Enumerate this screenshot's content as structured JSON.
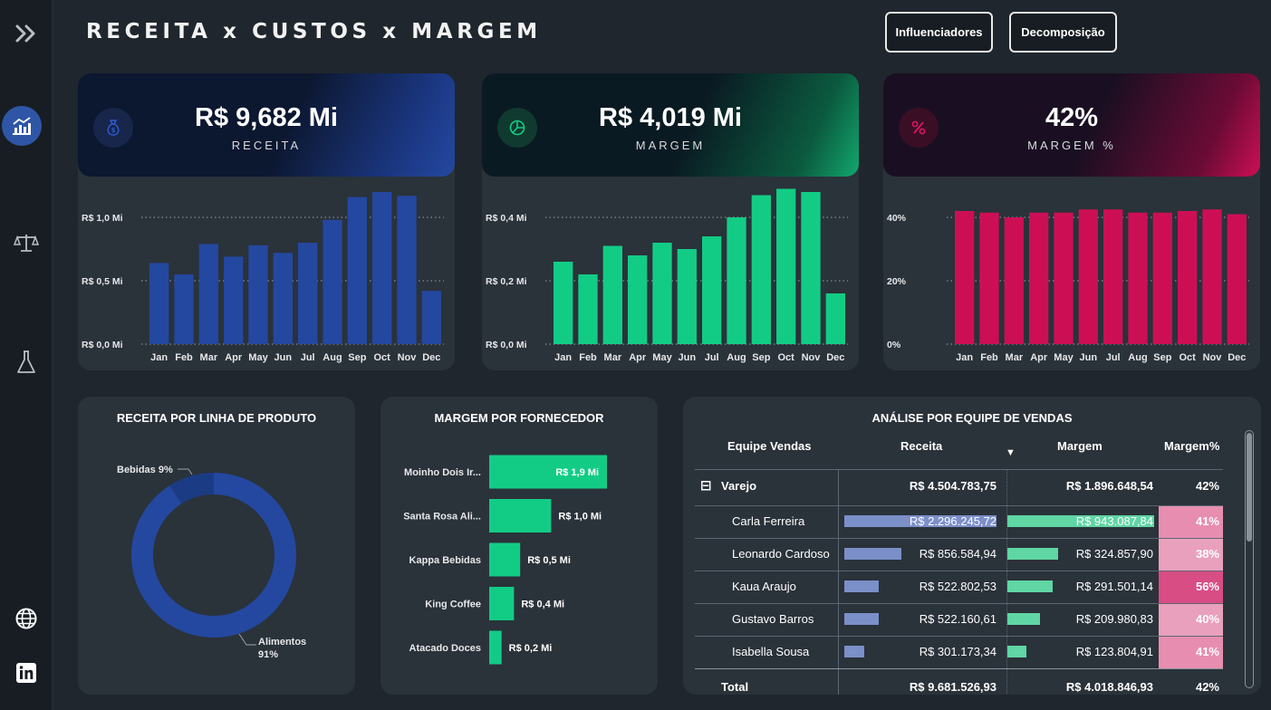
{
  "header": {
    "title": "RECEITA x CUSTOS x MARGEM",
    "buttons": {
      "influencers": "Influenciadores",
      "decomposition": "Decomposição"
    }
  },
  "sidebar": {
    "icons": [
      "expand-icon",
      "chart-trend-icon",
      "balance-scale-icon",
      "flask-icon",
      "globe-icon",
      "linkedin-icon"
    ]
  },
  "kpis": {
    "receita": {
      "value": "R$ 9,682 Mi",
      "label": "RECEITA",
      "color": "#2448a0"
    },
    "margem": {
      "value": "R$ 4,019 Mi",
      "label": "MARGEM",
      "color": "#12cc85"
    },
    "margem_pct": {
      "value": "42%",
      "label": "MARGEM %",
      "color": "#cc0f55"
    }
  },
  "chart_data": [
    {
      "type": "bar",
      "title": "",
      "categories": [
        "Jan",
        "Feb",
        "Mar",
        "Apr",
        "May",
        "Jun",
        "Jul",
        "Aug",
        "Sep",
        "Oct",
        "Nov",
        "Dec"
      ],
      "values": [
        0.64,
        0.55,
        0.79,
        0.69,
        0.78,
        0.72,
        0.8,
        0.98,
        1.16,
        1.2,
        1.17,
        0.42
      ],
      "ylim": [
        0,
        1.0
      ],
      "yticks": [
        0,
        0.5,
        1.0
      ],
      "ytick_labels": [
        "R$ 0,0 Mi",
        "R$ 0,5 Mi",
        "R$ 1,0 Mi"
      ],
      "color": "#2448a0",
      "grid": true
    },
    {
      "type": "bar",
      "title": "",
      "categories": [
        "Jan",
        "Feb",
        "Mar",
        "Apr",
        "May",
        "Jun",
        "Jul",
        "Aug",
        "Sep",
        "Oct",
        "Nov",
        "Dec"
      ],
      "values": [
        0.26,
        0.22,
        0.31,
        0.28,
        0.32,
        0.3,
        0.34,
        0.4,
        0.47,
        0.49,
        0.48,
        0.16
      ],
      "ylim": [
        0,
        0.4
      ],
      "yticks": [
        0,
        0.2,
        0.4
      ],
      "ytick_labels": [
        "R$ 0,0 Mi",
        "R$ 0,2 Mi",
        "R$ 0,4 Mi"
      ],
      "color": "#12cc85",
      "grid": true
    },
    {
      "type": "bar",
      "title": "",
      "categories": [
        "Jan",
        "Feb",
        "Mar",
        "Apr",
        "May",
        "Jun",
        "Jul",
        "Aug",
        "Sep",
        "Oct",
        "Nov",
        "Dec"
      ],
      "values": [
        42,
        41.5,
        40,
        41.5,
        41.5,
        42.5,
        42.5,
        41.5,
        41.5,
        42,
        42.5,
        41
      ],
      "ylim": [
        0,
        40
      ],
      "yticks": [
        0,
        20,
        40
      ],
      "ytick_labels": [
        "0%",
        "20%",
        "40%"
      ],
      "color": "#cc0f55",
      "grid": true
    },
    {
      "type": "pie",
      "title": "RECEITA POR LINHA DE PRODUTO",
      "categories": [
        "Bebidas",
        "Alimentos"
      ],
      "values": [
        9,
        91
      ],
      "labels": [
        "Bebidas 9%",
        "Alimentos",
        "91%"
      ],
      "colors": [
        "#1b3c84",
        "#2448a0"
      ]
    },
    {
      "type": "bar",
      "orientation": "horizontal",
      "title": "MARGEM POR FORNECEDOR",
      "categories": [
        "Moinho Dois Ir...",
        "Santa Rosa Ali...",
        "Kappa Bebidas",
        "King Coffee",
        "Atacado Doces"
      ],
      "values": [
        1.9,
        1.0,
        0.5,
        0.4,
        0.2
      ],
      "value_labels": [
        "R$ 1,9 Mi",
        "R$ 1,0 Mi",
        "R$ 0,5 Mi",
        "R$ 0,4 Mi",
        "R$ 0,2 Mi"
      ],
      "color": "#12cc85"
    },
    {
      "type": "table",
      "title": "ANÁLISE POR EQUIPE DE VENDAS",
      "columns": [
        "Equipe Vendas",
        "Receita",
        "Margem",
        "Margem%"
      ],
      "group": {
        "name": "Varejo",
        "receita": "R$ 4.504.783,75",
        "margem": "R$ 1.896.648,54",
        "pct": "42%"
      },
      "rows": [
        {
          "name": "Carla Ferreira",
          "receita": "R$ 2.296.245,72",
          "margem": "R$ 943.087,84",
          "pct": "41%",
          "receita_v": 2296245.72,
          "margem_v": 943087.84,
          "pct_v": 41
        },
        {
          "name": "Leonardo Cardoso",
          "receita": "R$ 856.584,94",
          "margem": "R$ 324.857,90",
          "pct": "38%",
          "receita_v": 856584.94,
          "margem_v": 324857.9,
          "pct_v": 38
        },
        {
          "name": "Kaua Araujo",
          "receita": "R$ 522.802,53",
          "margem": "R$ 291.501,14",
          "pct": "56%",
          "receita_v": 522802.53,
          "margem_v": 291501.14,
          "pct_v": 56
        },
        {
          "name": "Gustavo Barros",
          "receita": "R$ 522.160,61",
          "margem": "R$ 209.980,83",
          "pct": "40%",
          "receita_v": 522160.61,
          "margem_v": 209980.83,
          "pct_v": 40
        },
        {
          "name": "Isabella Sousa",
          "receita": "R$ 301.173,34",
          "margem": "R$ 123.804,91",
          "pct": "41%",
          "receita_v": 301173.34,
          "margem_v": 123804.91,
          "pct_v": 41
        }
      ],
      "total": {
        "name": "Total",
        "receita": "R$ 9.681.526,93",
        "margem": "R$ 4.018.846,93",
        "pct": "42%"
      },
      "sort_indicator": "▼",
      "collapse_icon": "⊟"
    }
  ]
}
